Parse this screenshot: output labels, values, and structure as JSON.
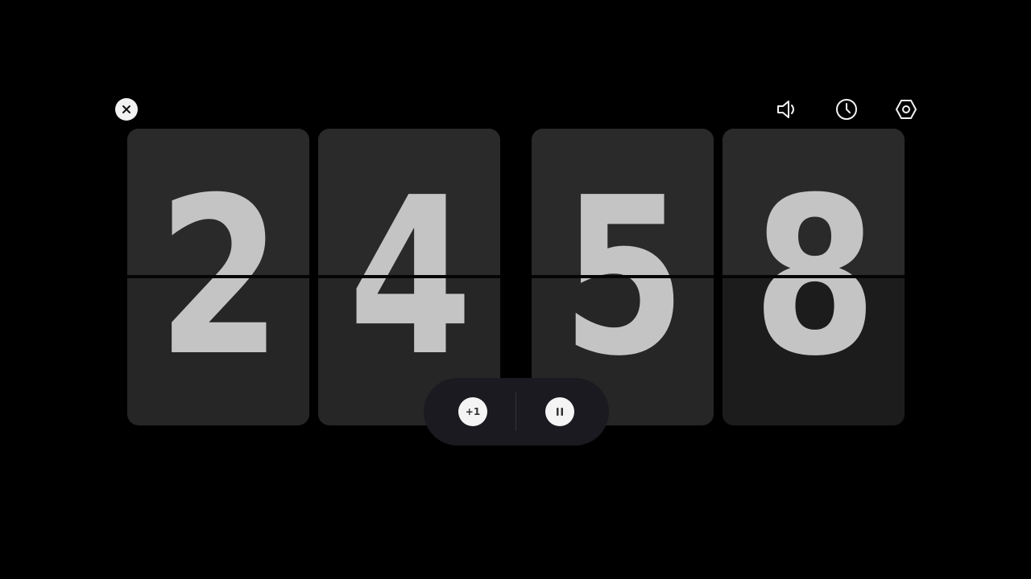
{
  "controls": {
    "close": "close-icon",
    "sound": "volume-icon",
    "clock": "clock-icon",
    "settings": "settings-icon"
  },
  "digits": [
    "2",
    "4",
    "5",
    "8"
  ],
  "pill": {
    "add_label": "+1",
    "pause": "pause-icon"
  },
  "colors": {
    "background": "#000000",
    "card": "#262626",
    "digit": "#c4c4c4",
    "pill": "#1b1a20",
    "icon": "#f2f2f2"
  }
}
